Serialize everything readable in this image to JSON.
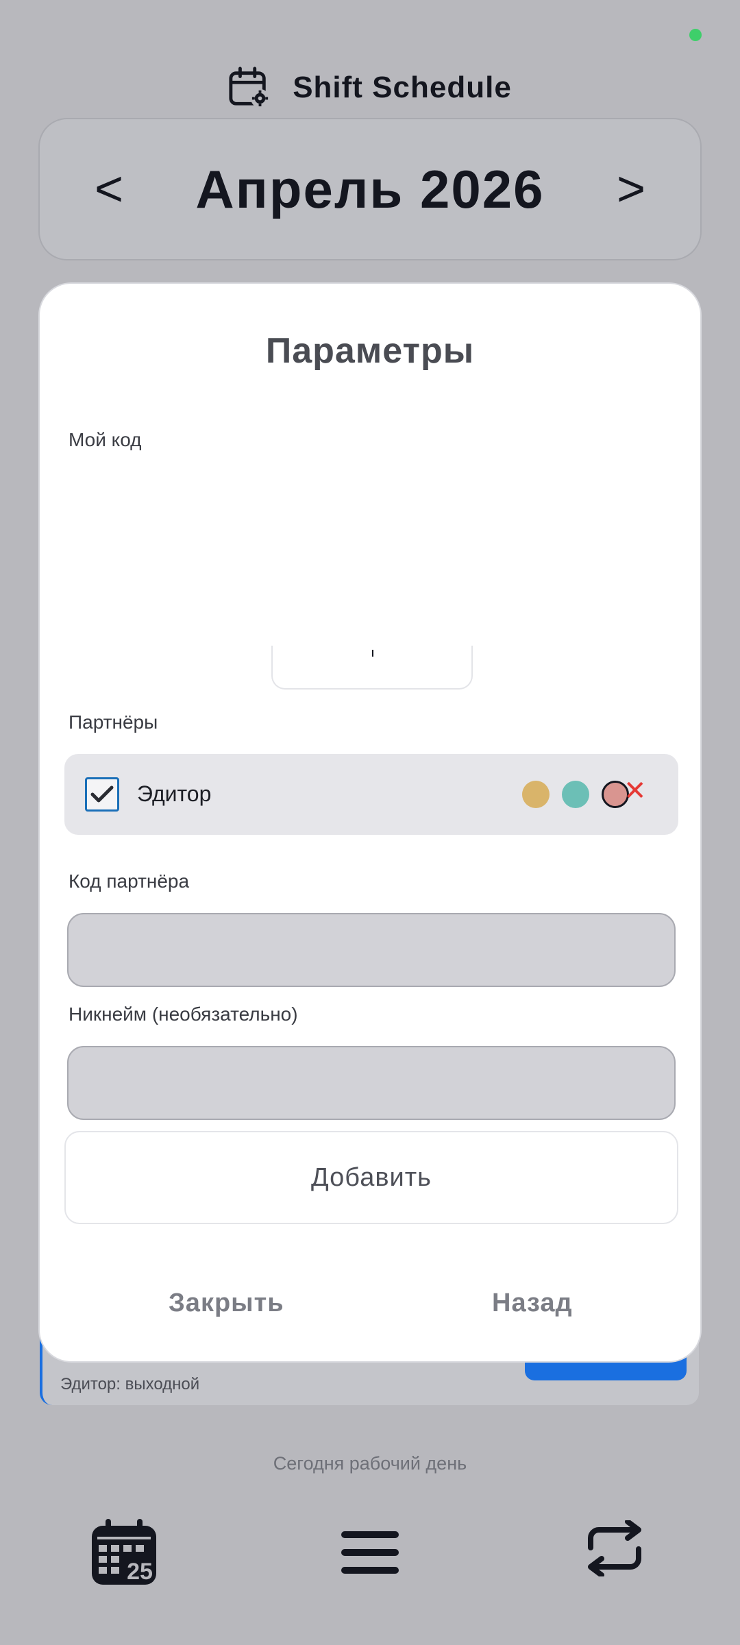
{
  "header": {
    "app_title": "Shift Schedule",
    "app_icon": "calendar-gear-icon"
  },
  "month_nav": {
    "prev_label": "<",
    "next_label": ">",
    "month_label": "Апрель 2026"
  },
  "modal": {
    "title": "Параметры",
    "my_code_label": "Мой код",
    "partners_label": "Партнёры",
    "partners": [
      {
        "name": "Эдитор",
        "checked": true,
        "colors": [
          "#d9b46a",
          "#6cbfb6",
          "#d99590"
        ],
        "selected_color_index": 2
      }
    ],
    "partner_code_label": "Код партнёра",
    "partner_code_value": "",
    "nickname_label": "Никнейм (необязательно)",
    "nickname_value": "",
    "add_label": "Добавить",
    "close_label": "Закрыть",
    "back_label": "Назад"
  },
  "underlay": {
    "partner_status": "Эдитор: выходной",
    "today_status": "Сегодня рабочий день"
  },
  "bottom_nav": {
    "items": [
      "calendar-25-icon",
      "menu-icon",
      "sync-icon"
    ],
    "calendar_day": "25"
  },
  "colors": {
    "accent": "#1a6fe0",
    "remove": "#e53935",
    "status_online": "#3ecf6a"
  }
}
